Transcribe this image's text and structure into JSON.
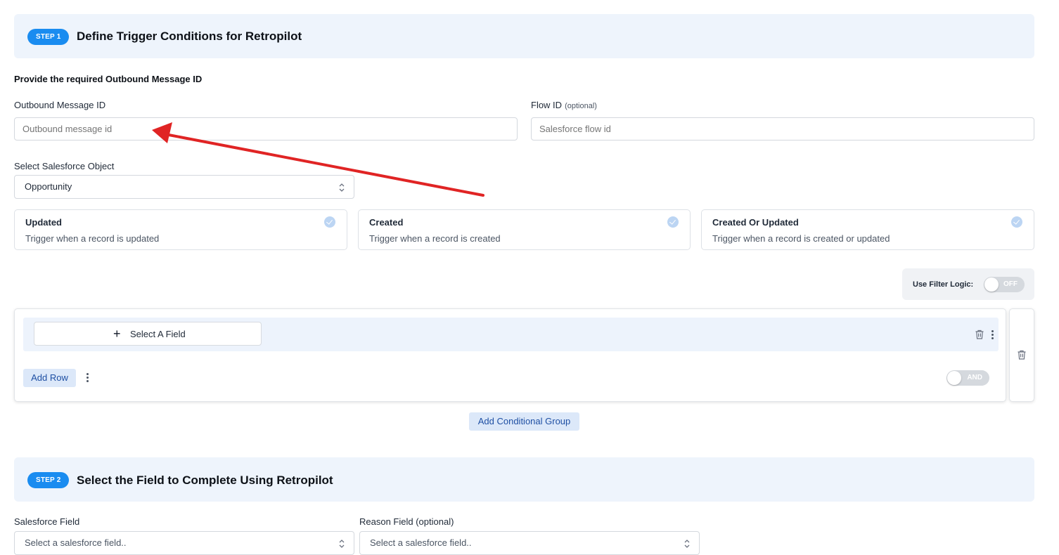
{
  "step1": {
    "badge": "STEP 1",
    "title": "Define Trigger Conditions for Retropilot",
    "subtitle": "Provide the required Outbound Message ID",
    "outbound_label": "Outbound Message ID",
    "outbound_placeholder": "Outbound message id",
    "flow_label": "Flow ID",
    "flow_optional": "(optional)",
    "flow_placeholder": "Salesforce flow id",
    "object_label": "Select Salesforce Object",
    "object_value": "Opportunity",
    "trigger_options": [
      {
        "title": "Updated",
        "description": "Trigger when a record is updated"
      },
      {
        "title": "Created",
        "description": "Trigger when a record is created"
      },
      {
        "title": "Created Or Updated",
        "description": "Trigger when a record is created or updated"
      }
    ],
    "filter_logic_label": "Use Filter Logic:",
    "filter_logic_state": "OFF",
    "condition_group": {
      "select_field_label": "Select A Field",
      "add_row_label": "Add Row",
      "conjunction": "AND"
    },
    "add_group_label": "Add Conditional Group"
  },
  "step2": {
    "badge": "STEP 2",
    "title": "Select the Field to Complete Using Retropilot",
    "salesforce_field_label": "Salesforce Field",
    "salesforce_field_placeholder": "Select a salesforce field..",
    "reason_field_label": "Reason Field (optional)",
    "reason_field_placeholder": "Select a salesforce field.."
  },
  "colors": {
    "accent": "#1a8cf0",
    "header_bg": "#eef4fc",
    "annotation_arrow": "#e02424"
  },
  "icons": [
    "check-circle-icon",
    "plus-icon",
    "trash-icon",
    "kebab-menu-icon",
    "chevron-up-down-icon"
  ]
}
